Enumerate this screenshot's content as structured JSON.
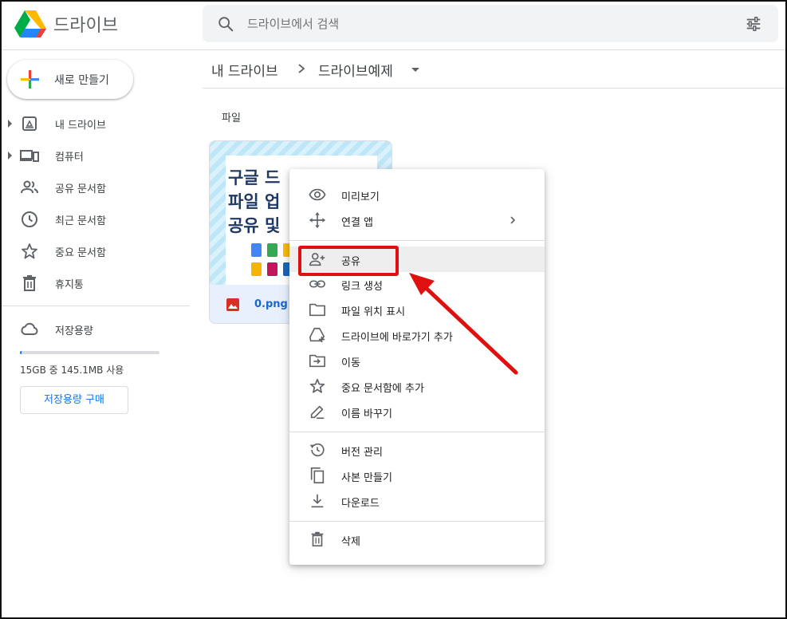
{
  "header": {
    "app_title": "드라이브",
    "search_placeholder": "드라이브에서 검색"
  },
  "sidebar": {
    "new_button_label": "새로 만들기",
    "items": [
      {
        "label": "내 드라이브",
        "icon": "my-drive-icon",
        "expandable": true
      },
      {
        "label": "컴퓨터",
        "icon": "computers-icon",
        "expandable": true
      },
      {
        "label": "공유 문서함",
        "icon": "shared-icon",
        "expandable": false
      },
      {
        "label": "최근 문서함",
        "icon": "clock-icon",
        "expandable": false
      },
      {
        "label": "중요 문서함",
        "icon": "star-icon",
        "expandable": false
      },
      {
        "label": "휴지통",
        "icon": "trash-icon",
        "expandable": false
      }
    ],
    "storage": {
      "label": "저장용량",
      "usage_text": "15GB 중 145.1MB 사용",
      "used_fraction": 0.01,
      "buy_button_label": "저장용량 구매"
    }
  },
  "breadcrumb": {
    "root": "내 드라이브",
    "current": "드라이브예제"
  },
  "main": {
    "section_label": "파일",
    "file": {
      "name": "0.png",
      "thumbnail_lines": [
        "구글 드",
        "파일 업",
        "공유 및"
      ]
    }
  },
  "context_menu": {
    "items": [
      {
        "label": "미리보기",
        "icon": "eye-icon"
      },
      {
        "label": "연결 앱",
        "icon": "move-arrows-icon",
        "submenu": true
      },
      {
        "label": "공유",
        "icon": "person-add-icon",
        "highlighted": true
      },
      {
        "label": "링크 생성",
        "icon": "link-icon"
      },
      {
        "label": "파일 위치 표시",
        "icon": "folder-icon"
      },
      {
        "label": "드라이브에 바로가기 추가",
        "icon": "shortcut-add-icon"
      },
      {
        "label": "이동",
        "icon": "folder-move-icon"
      },
      {
        "label": "중요 문서함에 추가",
        "icon": "star-icon"
      },
      {
        "label": "이름 바꾸기",
        "icon": "pencil-icon"
      },
      {
        "label": "버전 관리",
        "icon": "history-icon"
      },
      {
        "label": "사본 만들기",
        "icon": "copy-icon"
      },
      {
        "label": "다운로드",
        "icon": "download-icon"
      },
      {
        "label": "삭제",
        "icon": "trash-icon"
      }
    ]
  },
  "colors": {
    "accent": "#1a73e8",
    "annotation": "#e01010",
    "highlight_row": "#eeeeee"
  }
}
